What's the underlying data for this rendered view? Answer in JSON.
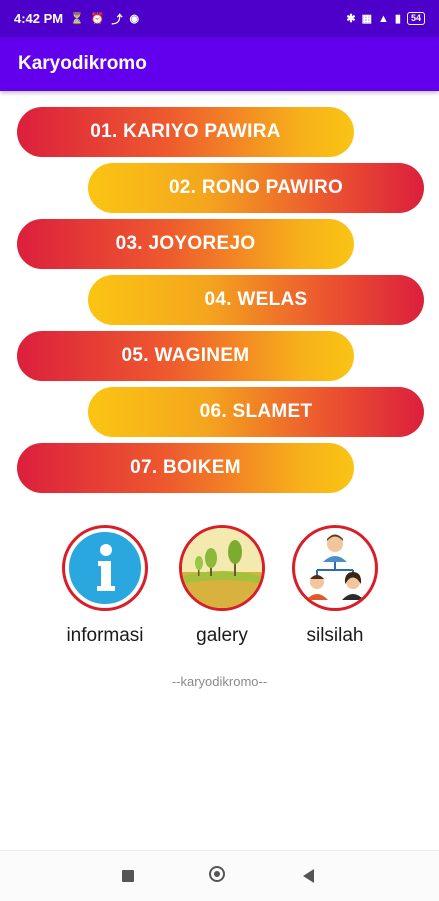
{
  "status_bar": {
    "time": "4:42 PM",
    "left_icons": [
      "alarm-off-icon",
      "alarm-clock-icon",
      "app-notification-icon",
      "facebook-icon"
    ],
    "right_icons": [
      "bluetooth-icon",
      "vibrate-icon",
      "signal-4g-icon",
      "signal-bars-icon"
    ],
    "battery": "54"
  },
  "app_bar": {
    "title": "Karyodikromo"
  },
  "menu": {
    "items": [
      {
        "label": "01. KARIYO PAWIRA"
      },
      {
        "label": "02. RONO PAWIRO"
      },
      {
        "label": "03. JOYOREJO"
      },
      {
        "label": "04. WELAS"
      },
      {
        "label": "05. WAGINEM"
      },
      {
        "label": "06. SLAMET"
      },
      {
        "label": "07. BOIKEM"
      }
    ]
  },
  "icons": {
    "informasi": {
      "label": "informasi",
      "icon": "info-icon"
    },
    "galery": {
      "label": "galery",
      "icon": "landscape-icon"
    },
    "silsilah": {
      "label": "silsilah",
      "icon": "family-tree-icon"
    }
  },
  "footer": {
    "text": "--karyodikromo--"
  },
  "colors": {
    "status_bar": "#4c00c9",
    "app_bar": "#6200ee",
    "gradient_red": "#dc1f3d",
    "gradient_yellow": "#f9c414",
    "circle_border": "#d81e28"
  }
}
